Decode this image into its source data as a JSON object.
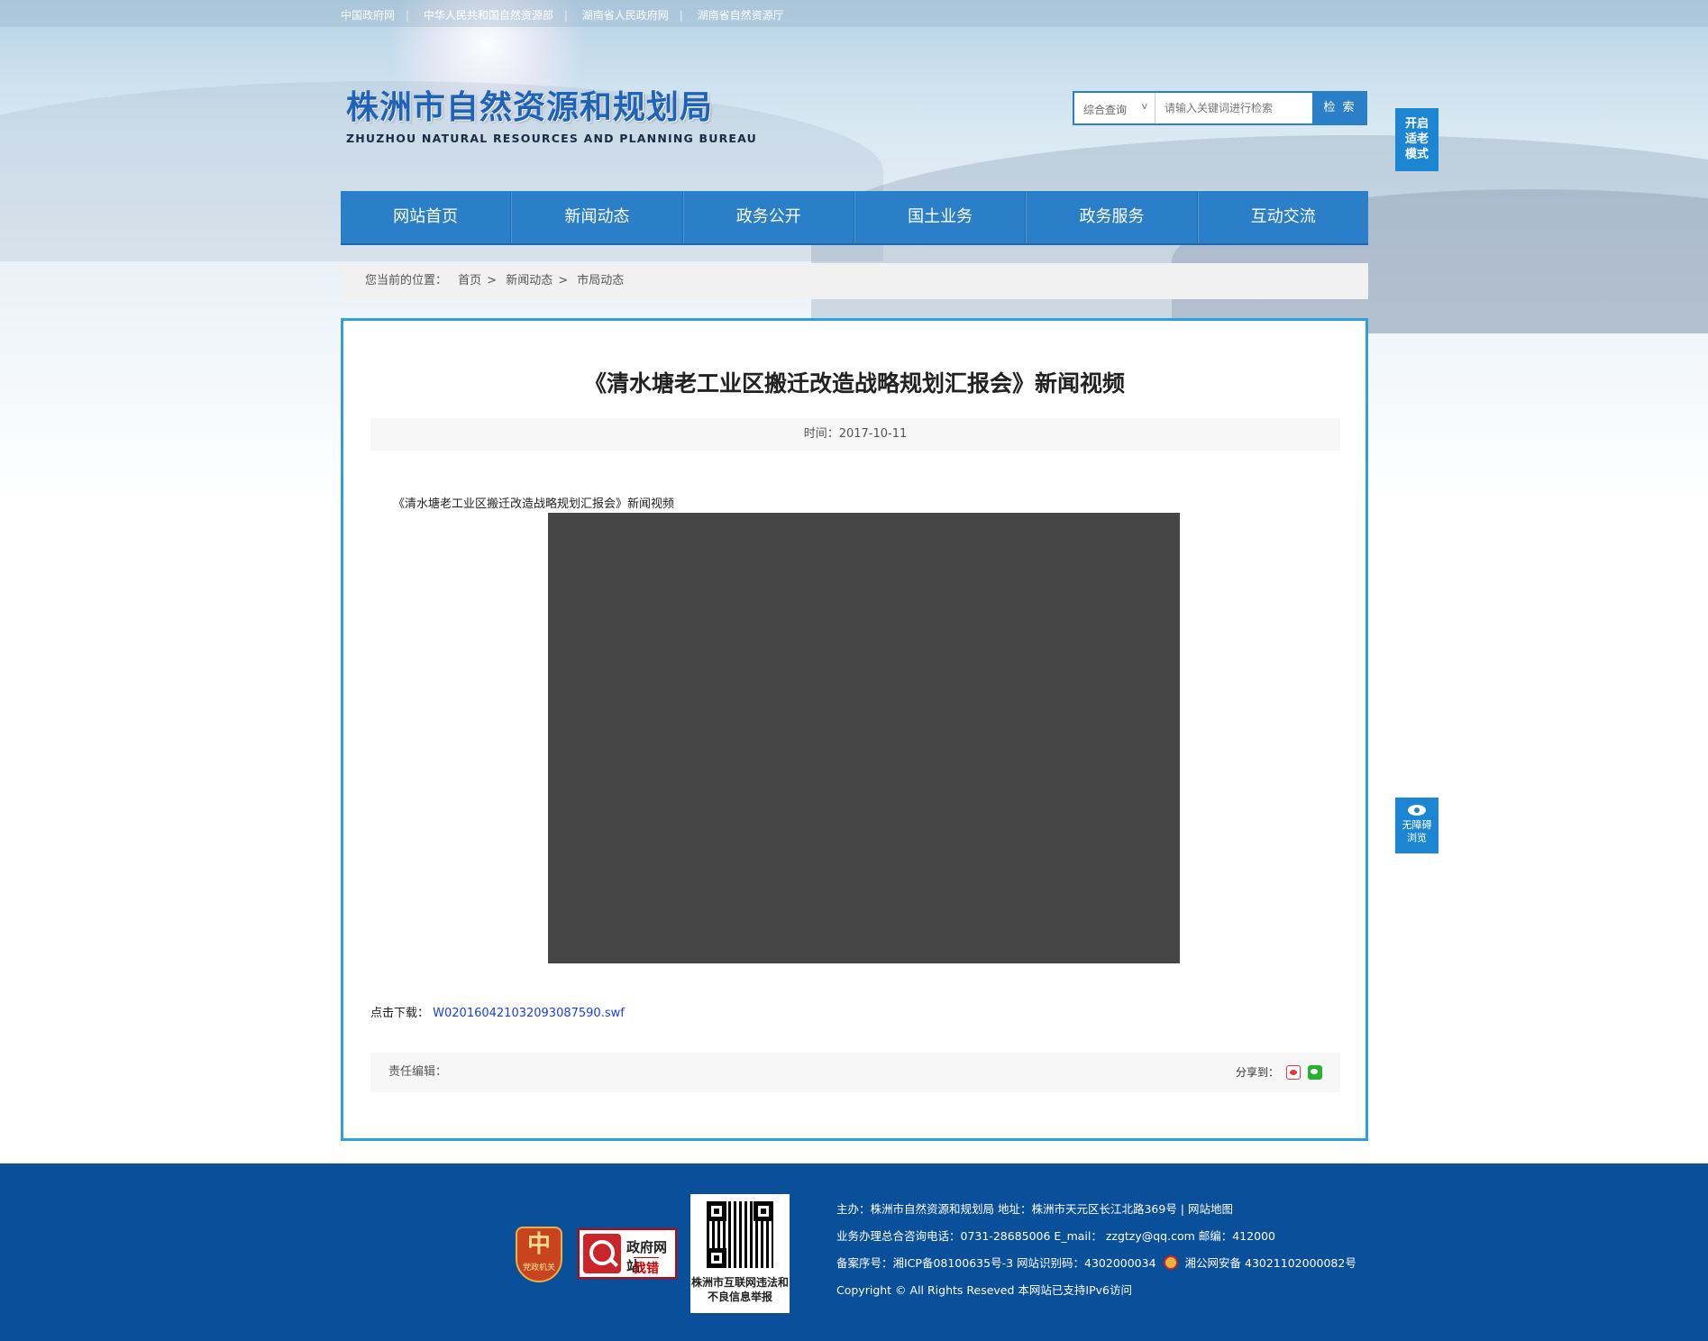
{
  "toplinks": [
    "中国政府网",
    "中华人民共和国自然资源部",
    "湖南省人民政府网",
    "湖南省自然资源厅"
  ],
  "logo": {
    "cn": "株洲市自然资源和规划局",
    "en": "ZHUZHOU NATURAL RESOURCES AND PLANNING BUREAU"
  },
  "search": {
    "select_label": "综合查询",
    "placeholder": "请输入关键词进行检索",
    "button": "检 索"
  },
  "side": {
    "elder_mode": "开启适老模式",
    "accessible": "无障碍浏览"
  },
  "nav": [
    "网站首页",
    "新闻动态",
    "政务公开",
    "国土业务",
    "政务服务",
    "互动交流"
  ],
  "breadcrumb": {
    "label": "您当前的位置：",
    "items": [
      "首页",
      "新闻动态",
      "市局动态"
    ]
  },
  "article": {
    "title": "《清水塘老工业区搬迁改造战略规划汇报会》新闻视频",
    "date": "时间：2017-10-11",
    "intro": "《清水塘老工业区搬迁改造战略规划汇报会》新闻视频",
    "download_label": "点击下载：",
    "download_file": "W020160421032093087590.swf",
    "editor_label": "责任编辑：",
    "share_label": "分享到："
  },
  "footer": {
    "badge_text": "党政机关",
    "findbug_title": "政府网站",
    "findbug_sub": "找错",
    "qr_caption": "株洲市互联网违法和不良信息举报",
    "line1": "主办：株洲市自然资源和规划局   地址：株洲市天元区长江北路369号  |  网站地图",
    "line2": "业务办理总合咨询电话：0731-28685006    E_mail：  zzgtzy@qq.com     邮编：412000",
    "line3a": "备案序号：湘ICP备08100635号-3  网站识别码：4302000034",
    "line3b": "湘公网安备 43021102000082号",
    "line4": "Copyright © All Rights Reseved 本网站已支持IPv6访问"
  },
  "colors": {
    "nav_blue": "#2b7fc8",
    "content_border": "#2ea0dc",
    "footer_bg": "#0a4f9a",
    "link_blue": "#1a3fd9"
  }
}
